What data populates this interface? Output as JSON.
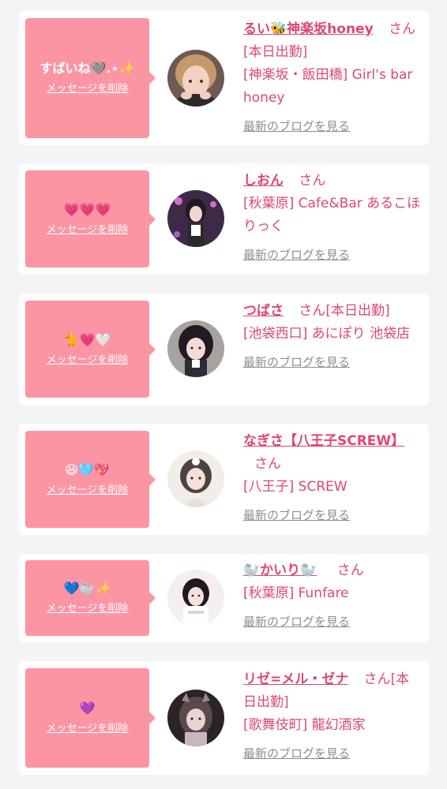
{
  "delete_label": "メッセージを削除",
  "blog_label": "最新のブログを見る",
  "honorific": "さん",
  "cards": [
    {
      "message": "すばいね🩶.⋆✨",
      "name": "るい🐝神楽坂honey",
      "status": "[本日出勤]",
      "shop": "[神楽坂・飯田橋] Girl's bar honey"
    },
    {
      "message": "💗💗💗",
      "name": "しおん",
      "status": "",
      "shop": "[秋葉原] Cafe&Bar あるこほりっく"
    },
    {
      "message": "🐈💗🤍",
      "name": "つばさ",
      "status": "[本日出勤]",
      "shop": "[池袋西口] あにぽり 池袋店"
    },
    {
      "message": "😆🩵💖",
      "name": "なぎさ【八王子SCREW】",
      "status": "",
      "shop": "[八王子] SCREW"
    },
    {
      "message": "💙🦭✨",
      "name": "🦭かいり🦭",
      "status": "",
      "shop": "[秋葉原] Funfare"
    },
    {
      "message": "💜",
      "name": "リゼ=メル・ゼナ",
      "status": "[本日出勤]",
      "shop": "[歌舞伎町] 龍幻酒家"
    }
  ],
  "colors": {
    "bubble": "#fc95a3",
    "accent": "#e04672",
    "muted": "#8d8d8d",
    "background": "#f4f4f6"
  }
}
